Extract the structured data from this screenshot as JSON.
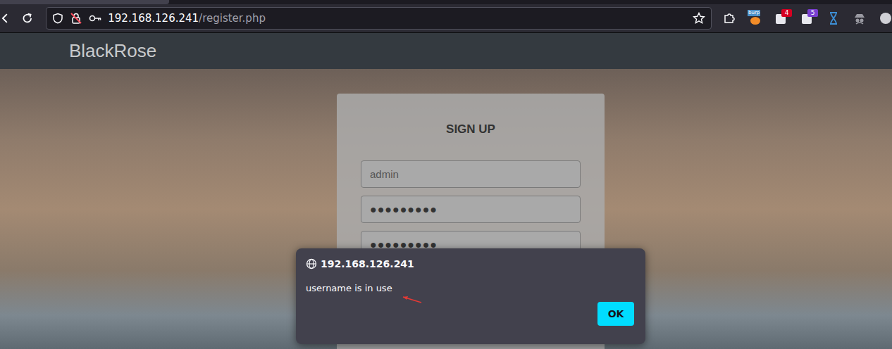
{
  "browser": {
    "address": {
      "host": "192.168.126.241",
      "path": "/register.php"
    },
    "bookmarked": false,
    "extensions": [
      {
        "kind": "puzzle",
        "label": "",
        "badge": "",
        "color": "#fbfbfe"
      },
      {
        "kind": "burp",
        "label": "burp",
        "badge": "",
        "color": "#f28c28"
      },
      {
        "kind": "badge",
        "label": "",
        "badge": "4",
        "color": "#d70022"
      },
      {
        "kind": "badge",
        "label": "",
        "badge": "5",
        "color": "#7a3fd1"
      },
      {
        "kind": "hourglass",
        "label": "",
        "badge": "",
        "color": "#3d8fd6"
      },
      {
        "kind": "spy",
        "label": "",
        "badge": "",
        "color": "#9a9aa2"
      },
      {
        "kind": "circle",
        "label": "",
        "badge": "",
        "color": "#d0d0d6"
      }
    ]
  },
  "page": {
    "brand": "BlackRose",
    "form": {
      "title": "SIGN UP",
      "fields": [
        {
          "kind": "text",
          "value": "admin"
        },
        {
          "kind": "password",
          "value": "●●●●●●●●●"
        },
        {
          "kind": "password",
          "value": "●●●●●●●●●"
        }
      ]
    }
  },
  "dialog": {
    "origin": "192.168.126.241",
    "message": "username is in use",
    "button": "OK"
  }
}
